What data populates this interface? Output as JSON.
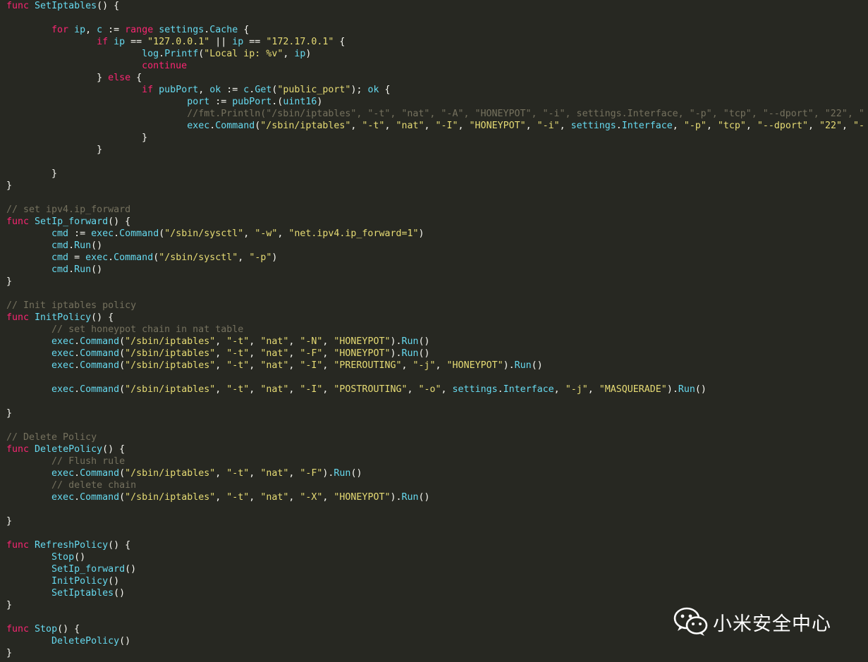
{
  "code_lines": [
    [
      [
        "kw",
        "func"
      ],
      [
        "pl",
        " "
      ],
      [
        "fn",
        "SetIptables"
      ],
      [
        "pl",
        "() {"
      ]
    ],
    [],
    [
      [
        "pl",
        "        "
      ],
      [
        "kw",
        "for"
      ],
      [
        "pl",
        " "
      ],
      [
        "id",
        "ip"
      ],
      [
        "pl",
        ", "
      ],
      [
        "id",
        "c"
      ],
      [
        "pl",
        " := "
      ],
      [
        "kw",
        "range"
      ],
      [
        "pl",
        " "
      ],
      [
        "id",
        "settings"
      ],
      [
        "pl",
        "."
      ],
      [
        "fn",
        "Cache"
      ],
      [
        "pl",
        " {"
      ]
    ],
    [
      [
        "pl",
        "                "
      ],
      [
        "kw",
        "if"
      ],
      [
        "pl",
        " "
      ],
      [
        "id",
        "ip"
      ],
      [
        "pl",
        " == "
      ],
      [
        "str",
        "\"127.0.0.1\""
      ],
      [
        "pl",
        " || "
      ],
      [
        "id",
        "ip"
      ],
      [
        "pl",
        " == "
      ],
      [
        "str",
        "\"172.17.0.1\""
      ],
      [
        "pl",
        " {"
      ]
    ],
    [
      [
        "pl",
        "                        "
      ],
      [
        "id",
        "log"
      ],
      [
        "pl",
        "."
      ],
      [
        "fn",
        "Printf"
      ],
      [
        "pl",
        "("
      ],
      [
        "str",
        "\"Local ip: %v\""
      ],
      [
        "pl",
        ", "
      ],
      [
        "id",
        "ip"
      ],
      [
        "pl",
        ")"
      ]
    ],
    [
      [
        "pl",
        "                        "
      ],
      [
        "kw",
        "continue"
      ]
    ],
    [
      [
        "pl",
        "                } "
      ],
      [
        "kw",
        "else"
      ],
      [
        "pl",
        " {"
      ]
    ],
    [
      [
        "pl",
        "                        "
      ],
      [
        "kw",
        "if"
      ],
      [
        "pl",
        " "
      ],
      [
        "id",
        "pubPort"
      ],
      [
        "pl",
        ", "
      ],
      [
        "id",
        "ok"
      ],
      [
        "pl",
        " := "
      ],
      [
        "id",
        "c"
      ],
      [
        "pl",
        "."
      ],
      [
        "fn",
        "Get"
      ],
      [
        "pl",
        "("
      ],
      [
        "str",
        "\"public_port\""
      ],
      [
        "pl",
        "); "
      ],
      [
        "id",
        "ok"
      ],
      [
        "pl",
        " {"
      ]
    ],
    [
      [
        "pl",
        "                                "
      ],
      [
        "id",
        "port"
      ],
      [
        "pl",
        " := "
      ],
      [
        "id",
        "pubPort"
      ],
      [
        "pl",
        ".("
      ],
      [
        "fn",
        "uint16"
      ],
      [
        "pl",
        ")"
      ]
    ],
    [
      [
        "pl",
        "                                "
      ],
      [
        "cm",
        "//fmt.Println(\"/sbin/iptables\", \"-t\", \"nat\", \"-A\", \"HONEYPOT\", \"-i\", settings.Interface, \"-p\", \"tcp\", \"--dport\", \"22\", \""
      ]
    ],
    [
      [
        "pl",
        "                                "
      ],
      [
        "id",
        "exec"
      ],
      [
        "pl",
        "."
      ],
      [
        "fn",
        "Command"
      ],
      [
        "pl",
        "("
      ],
      [
        "str",
        "\"/sbin/iptables\""
      ],
      [
        "pl",
        ", "
      ],
      [
        "str",
        "\"-t\""
      ],
      [
        "pl",
        ", "
      ],
      [
        "str",
        "\"nat\""
      ],
      [
        "pl",
        ", "
      ],
      [
        "str",
        "\"-I\""
      ],
      [
        "pl",
        ", "
      ],
      [
        "str",
        "\"HONEYPOT\""
      ],
      [
        "pl",
        ", "
      ],
      [
        "str",
        "\"-i\""
      ],
      [
        "pl",
        ", "
      ],
      [
        "id",
        "settings"
      ],
      [
        "pl",
        "."
      ],
      [
        "fn",
        "Interface"
      ],
      [
        "pl",
        ", "
      ],
      [
        "str",
        "\"-p\""
      ],
      [
        "pl",
        ", "
      ],
      [
        "str",
        "\"tcp\""
      ],
      [
        "pl",
        ", "
      ],
      [
        "str",
        "\"--dport\""
      ],
      [
        "pl",
        ", "
      ],
      [
        "str",
        "\"22\""
      ],
      [
        "pl",
        ", "
      ],
      [
        "str",
        "\"-"
      ]
    ],
    [
      [
        "pl",
        "                        }"
      ]
    ],
    [
      [
        "pl",
        "                }"
      ]
    ],
    [],
    [
      [
        "pl",
        "        }"
      ]
    ],
    [
      [
        "pl",
        "}"
      ]
    ],
    [],
    [
      [
        "cm",
        "// set ipv4.ip_forward"
      ]
    ],
    [
      [
        "kw",
        "func"
      ],
      [
        "pl",
        " "
      ],
      [
        "fn",
        "SetIp_forward"
      ],
      [
        "pl",
        "() {"
      ]
    ],
    [
      [
        "pl",
        "        "
      ],
      [
        "id",
        "cmd"
      ],
      [
        "pl",
        " := "
      ],
      [
        "id",
        "exec"
      ],
      [
        "pl",
        "."
      ],
      [
        "fn",
        "Command"
      ],
      [
        "pl",
        "("
      ],
      [
        "str",
        "\"/sbin/sysctl\""
      ],
      [
        "pl",
        ", "
      ],
      [
        "str",
        "\"-w\""
      ],
      [
        "pl",
        ", "
      ],
      [
        "str",
        "\"net.ipv4.ip_forward=1\""
      ],
      [
        "pl",
        ")"
      ]
    ],
    [
      [
        "pl",
        "        "
      ],
      [
        "id",
        "cmd"
      ],
      [
        "pl",
        "."
      ],
      [
        "fn",
        "Run"
      ],
      [
        "pl",
        "()"
      ]
    ],
    [
      [
        "pl",
        "        "
      ],
      [
        "id",
        "cmd"
      ],
      [
        "pl",
        " = "
      ],
      [
        "id",
        "exec"
      ],
      [
        "pl",
        "."
      ],
      [
        "fn",
        "Command"
      ],
      [
        "pl",
        "("
      ],
      [
        "str",
        "\"/sbin/sysctl\""
      ],
      [
        "pl",
        ", "
      ],
      [
        "str",
        "\"-p\""
      ],
      [
        "pl",
        ")"
      ]
    ],
    [
      [
        "pl",
        "        "
      ],
      [
        "id",
        "cmd"
      ],
      [
        "pl",
        "."
      ],
      [
        "fn",
        "Run"
      ],
      [
        "pl",
        "()"
      ]
    ],
    [
      [
        "pl",
        "}"
      ]
    ],
    [],
    [
      [
        "cm",
        "// Init iptables policy"
      ]
    ],
    [
      [
        "kw",
        "func"
      ],
      [
        "pl",
        " "
      ],
      [
        "fn",
        "InitPolicy"
      ],
      [
        "pl",
        "() {"
      ]
    ],
    [
      [
        "pl",
        "        "
      ],
      [
        "cm",
        "// set honeypot chain in nat table"
      ]
    ],
    [
      [
        "pl",
        "        "
      ],
      [
        "id",
        "exec"
      ],
      [
        "pl",
        "."
      ],
      [
        "fn",
        "Command"
      ],
      [
        "pl",
        "("
      ],
      [
        "str",
        "\"/sbin/iptables\""
      ],
      [
        "pl",
        ", "
      ],
      [
        "str",
        "\"-t\""
      ],
      [
        "pl",
        ", "
      ],
      [
        "str",
        "\"nat\""
      ],
      [
        "pl",
        ", "
      ],
      [
        "str",
        "\"-N\""
      ],
      [
        "pl",
        ", "
      ],
      [
        "str",
        "\"HONEYPOT\""
      ],
      [
        "pl",
        ")."
      ],
      [
        "fn",
        "Run"
      ],
      [
        "pl",
        "()"
      ]
    ],
    [
      [
        "pl",
        "        "
      ],
      [
        "id",
        "exec"
      ],
      [
        "pl",
        "."
      ],
      [
        "fn",
        "Command"
      ],
      [
        "pl",
        "("
      ],
      [
        "str",
        "\"/sbin/iptables\""
      ],
      [
        "pl",
        ", "
      ],
      [
        "str",
        "\"-t\""
      ],
      [
        "pl",
        ", "
      ],
      [
        "str",
        "\"nat\""
      ],
      [
        "pl",
        ", "
      ],
      [
        "str",
        "\"-F\""
      ],
      [
        "pl",
        ", "
      ],
      [
        "str",
        "\"HONEYPOT\""
      ],
      [
        "pl",
        ")."
      ],
      [
        "fn",
        "Run"
      ],
      [
        "pl",
        "()"
      ]
    ],
    [
      [
        "pl",
        "        "
      ],
      [
        "id",
        "exec"
      ],
      [
        "pl",
        "."
      ],
      [
        "fn",
        "Command"
      ],
      [
        "pl",
        "("
      ],
      [
        "str",
        "\"/sbin/iptables\""
      ],
      [
        "pl",
        ", "
      ],
      [
        "str",
        "\"-t\""
      ],
      [
        "pl",
        ", "
      ],
      [
        "str",
        "\"nat\""
      ],
      [
        "pl",
        ", "
      ],
      [
        "str",
        "\"-I\""
      ],
      [
        "pl",
        ", "
      ],
      [
        "str",
        "\"PREROUTING\""
      ],
      [
        "pl",
        ", "
      ],
      [
        "str",
        "\"-j\""
      ],
      [
        "pl",
        ", "
      ],
      [
        "str",
        "\"HONEYPOT\""
      ],
      [
        "pl",
        ")."
      ],
      [
        "fn",
        "Run"
      ],
      [
        "pl",
        "()"
      ]
    ],
    [],
    [
      [
        "pl",
        "        "
      ],
      [
        "id",
        "exec"
      ],
      [
        "pl",
        "."
      ],
      [
        "fn",
        "Command"
      ],
      [
        "pl",
        "("
      ],
      [
        "str",
        "\"/sbin/iptables\""
      ],
      [
        "pl",
        ", "
      ],
      [
        "str",
        "\"-t\""
      ],
      [
        "pl",
        ", "
      ],
      [
        "str",
        "\"nat\""
      ],
      [
        "pl",
        ", "
      ],
      [
        "str",
        "\"-I\""
      ],
      [
        "pl",
        ", "
      ],
      [
        "str",
        "\"POSTROUTING\""
      ],
      [
        "pl",
        ", "
      ],
      [
        "str",
        "\"-o\""
      ],
      [
        "pl",
        ", "
      ],
      [
        "id",
        "settings"
      ],
      [
        "pl",
        "."
      ],
      [
        "fn",
        "Interface"
      ],
      [
        "pl",
        ", "
      ],
      [
        "str",
        "\"-j\""
      ],
      [
        "pl",
        ", "
      ],
      [
        "str",
        "\"MASQUERADE\""
      ],
      [
        "pl",
        ")."
      ],
      [
        "fn",
        "Run"
      ],
      [
        "pl",
        "()"
      ]
    ],
    [],
    [
      [
        "pl",
        "}"
      ]
    ],
    [],
    [
      [
        "cm",
        "// Delete Policy"
      ]
    ],
    [
      [
        "kw",
        "func"
      ],
      [
        "pl",
        " "
      ],
      [
        "fn",
        "DeletePolicy"
      ],
      [
        "pl",
        "() {"
      ]
    ],
    [
      [
        "pl",
        "        "
      ],
      [
        "cm",
        "// Flush rule"
      ]
    ],
    [
      [
        "pl",
        "        "
      ],
      [
        "id",
        "exec"
      ],
      [
        "pl",
        "."
      ],
      [
        "fn",
        "Command"
      ],
      [
        "pl",
        "("
      ],
      [
        "str",
        "\"/sbin/iptables\""
      ],
      [
        "pl",
        ", "
      ],
      [
        "str",
        "\"-t\""
      ],
      [
        "pl",
        ", "
      ],
      [
        "str",
        "\"nat\""
      ],
      [
        "pl",
        ", "
      ],
      [
        "str",
        "\"-F\""
      ],
      [
        "pl",
        ")."
      ],
      [
        "fn",
        "Run"
      ],
      [
        "pl",
        "()"
      ]
    ],
    [
      [
        "pl",
        "        "
      ],
      [
        "cm",
        "// delete chain"
      ]
    ],
    [
      [
        "pl",
        "        "
      ],
      [
        "id",
        "exec"
      ],
      [
        "pl",
        "."
      ],
      [
        "fn",
        "Command"
      ],
      [
        "pl",
        "("
      ],
      [
        "str",
        "\"/sbin/iptables\""
      ],
      [
        "pl",
        ", "
      ],
      [
        "str",
        "\"-t\""
      ],
      [
        "pl",
        ", "
      ],
      [
        "str",
        "\"nat\""
      ],
      [
        "pl",
        ", "
      ],
      [
        "str",
        "\"-X\""
      ],
      [
        "pl",
        ", "
      ],
      [
        "str",
        "\"HONEYPOT\""
      ],
      [
        "pl",
        ")."
      ],
      [
        "fn",
        "Run"
      ],
      [
        "pl",
        "()"
      ]
    ],
    [],
    [
      [
        "pl",
        "}"
      ]
    ],
    [],
    [
      [
        "kw",
        "func"
      ],
      [
        "pl",
        " "
      ],
      [
        "fn",
        "RefreshPolicy"
      ],
      [
        "pl",
        "() {"
      ]
    ],
    [
      [
        "pl",
        "        "
      ],
      [
        "fn",
        "Stop"
      ],
      [
        "pl",
        "()"
      ]
    ],
    [
      [
        "pl",
        "        "
      ],
      [
        "fn",
        "SetIp_forward"
      ],
      [
        "pl",
        "()"
      ]
    ],
    [
      [
        "pl",
        "        "
      ],
      [
        "fn",
        "InitPolicy"
      ],
      [
        "pl",
        "()"
      ]
    ],
    [
      [
        "pl",
        "        "
      ],
      [
        "fn",
        "SetIptables"
      ],
      [
        "pl",
        "()"
      ]
    ],
    [
      [
        "pl",
        "}"
      ]
    ],
    [],
    [
      [
        "kw",
        "func"
      ],
      [
        "pl",
        " "
      ],
      [
        "fn",
        "Stop"
      ],
      [
        "pl",
        "() {"
      ]
    ],
    [
      [
        "pl",
        "        "
      ],
      [
        "fn",
        "DeletePolicy"
      ],
      [
        "pl",
        "()"
      ]
    ],
    [
      [
        "pl",
        "}"
      ]
    ]
  ],
  "watermark": {
    "icon": "wechat-icon",
    "text": "小米安全中心"
  },
  "colors": {
    "background": "#272822",
    "keyword": "#f92672",
    "identifier": "#66d9ef",
    "string": "#e6db74",
    "comment": "#75715e",
    "plain": "#f8f8f2"
  }
}
